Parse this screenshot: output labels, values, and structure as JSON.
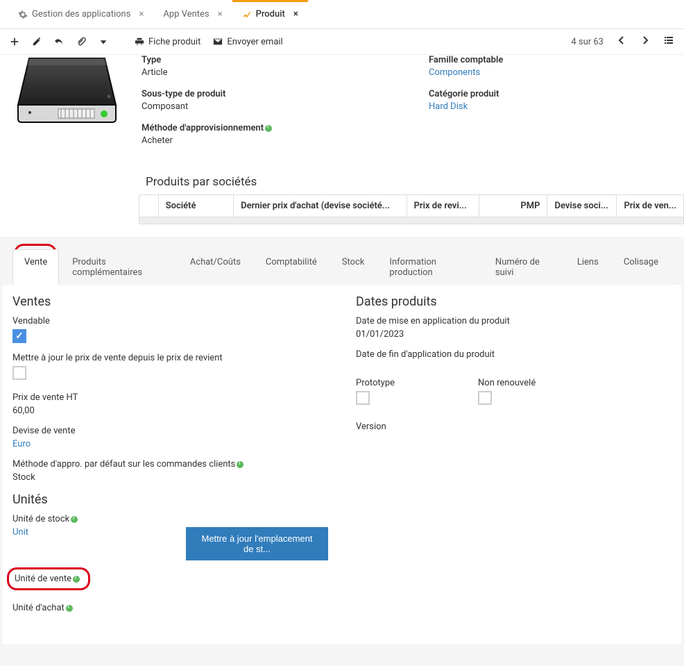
{
  "tabs": {
    "t0": "Gestion des applications",
    "t1": "App Ventes",
    "t2": "Produit"
  },
  "toolbar": {
    "print": "Fiche produit",
    "email": "Envoyer email",
    "pager": "4 sur 63"
  },
  "product": {
    "type_label": "Type",
    "type_value": "Article",
    "subtype_label": "Sous-type de produit",
    "subtype_value": "Composant",
    "method_label": "Méthode d'approvisionnement",
    "method_value": "Acheter",
    "family_label": "Famille comptable",
    "family_value": "Components",
    "category_label": "Catégorie produit",
    "category_value": "Hard Disk"
  },
  "companies": {
    "title": "Produits par sociétés",
    "cols": {
      "c1": "Société",
      "c2": "Dernier prix d'achat (devise société...",
      "c3": "Prix de revi...",
      "c4": "PMP",
      "c5": "Devise soci...",
      "c6": "Prix de ven..."
    }
  },
  "subtabs": {
    "t0": "Vente",
    "t1": "Produits complémentaires",
    "t2": "Achat/Coûts",
    "t3": "Comptabilité",
    "t4": "Stock",
    "t5": "Information production",
    "t6": "Numéro de suivi",
    "t7": "Liens",
    "t8": "Colisage"
  },
  "sale": {
    "heading": "Ventes",
    "vendable": "Vendable",
    "update_price": "Mettre à jour le prix de vente depuis le prix de revient",
    "price_label": "Prix de vente HT",
    "price_value": "60,00",
    "currency_label": "Devise de vente",
    "currency_value": "Euro",
    "default_method": "Méthode d'appro. par défaut sur les commandes clients",
    "default_method_value": "Stock",
    "units_heading": "Unités",
    "stock_unit_label": "Unité de stock",
    "stock_unit_value": "Unit",
    "update_location_btn": "Mettre à jour l'emplacement de st...",
    "sale_unit_label": "Unité de vente",
    "purchase_unit_label": "Unité d'achat"
  },
  "dates": {
    "heading": "Dates produits",
    "start_label": "Date de mise en application du produit",
    "start_value": "01/01/2023",
    "end_label": "Date de fin d'application du produit",
    "prototype_label": "Prototype",
    "nonrenewed_label": "Non renouvelé",
    "version_label": "Version"
  }
}
